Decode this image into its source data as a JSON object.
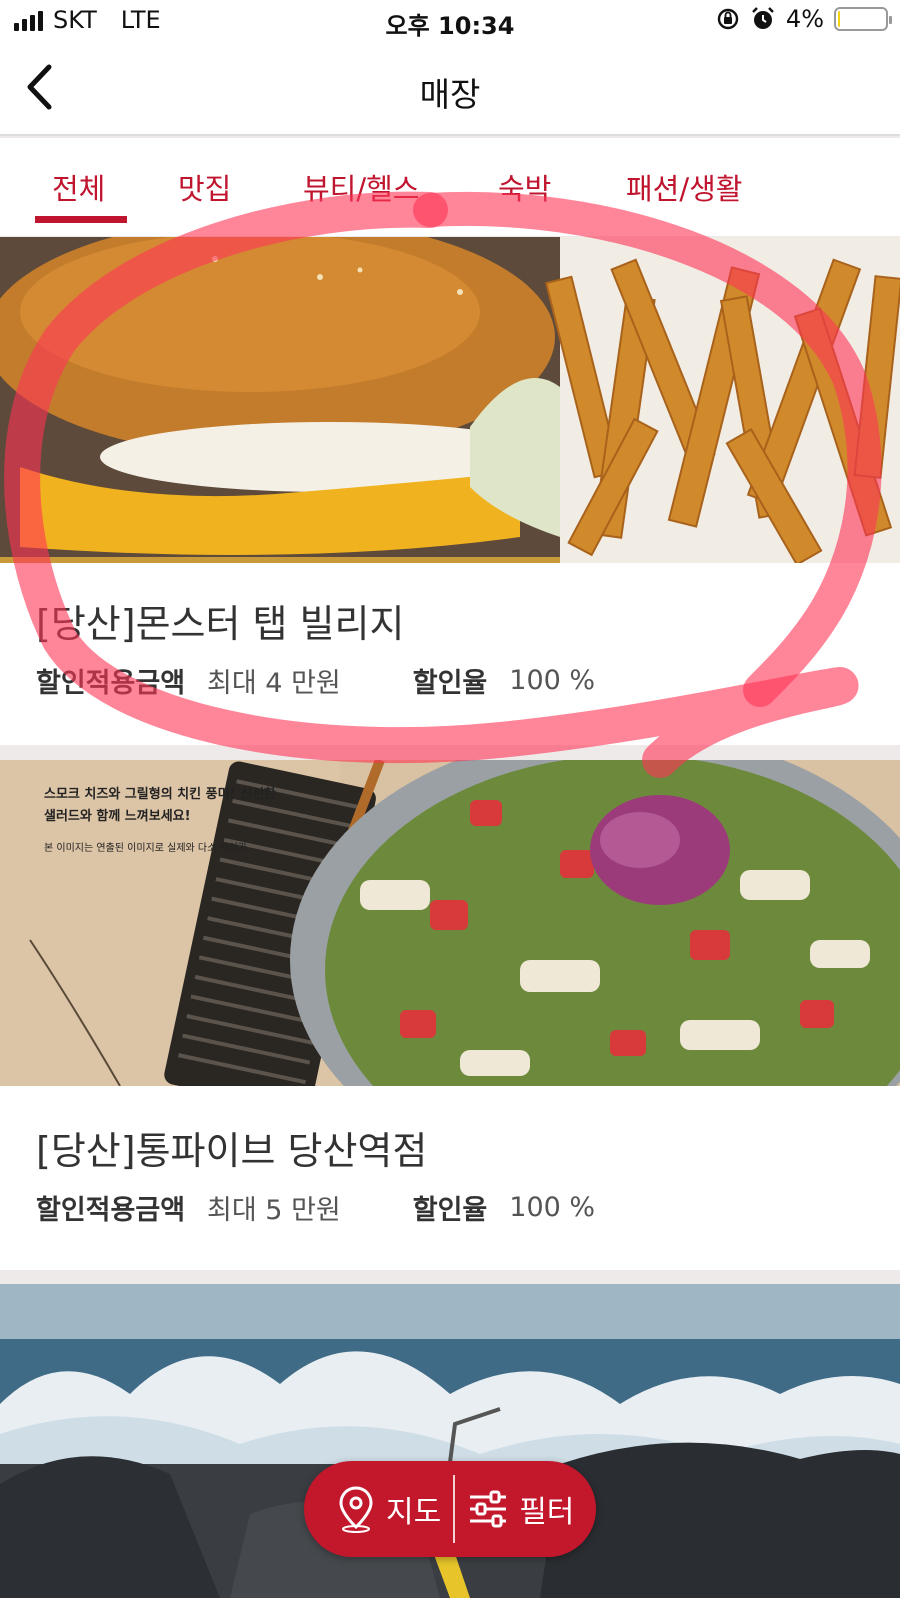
{
  "status_bar": {
    "carrier": "SKT",
    "network": "LTE",
    "time": "오후 10:34",
    "battery": "4%",
    "battery_level": 0.04
  },
  "header": {
    "title": "매장"
  },
  "tabs": [
    {
      "label": "전체",
      "active": true
    },
    {
      "label": "맛집",
      "active": false
    },
    {
      "label": "뷰티/헬스",
      "active": false
    },
    {
      "label": "숙박",
      "active": false
    },
    {
      "label": "패션/생활",
      "active": false
    }
  ],
  "stores": [
    {
      "name": "[당산]몬스터 탭 빌리지",
      "amount_label": "할인적용금액",
      "amount_value": "최대 4 만원",
      "rate_label": "할인율",
      "rate_value": "100 %",
      "image": "burger-and-fries-photo"
    },
    {
      "name": "[당산]통파이브 당산역점",
      "amount_label": "할인적용금액",
      "amount_value": "최대 5 만원",
      "rate_label": "할인율",
      "rate_value": "100 %",
      "image": "salad-photo",
      "image_text": {
        "line1": "스모크 치즈와 그릴형의 치킨 풍미! 신선한",
        "line2": "샐러드와 함께 느껴보세요!",
        "line3": "본 이미지는 연출된 이미지로 실제와 다소 차이가"
      }
    },
    {
      "image": "ocean-rocks-photo"
    }
  ],
  "fab": {
    "map_label": "지도",
    "filter_label": "필터"
  },
  "colors": {
    "accent": "#c0152f",
    "annotation": "#ff3355"
  }
}
